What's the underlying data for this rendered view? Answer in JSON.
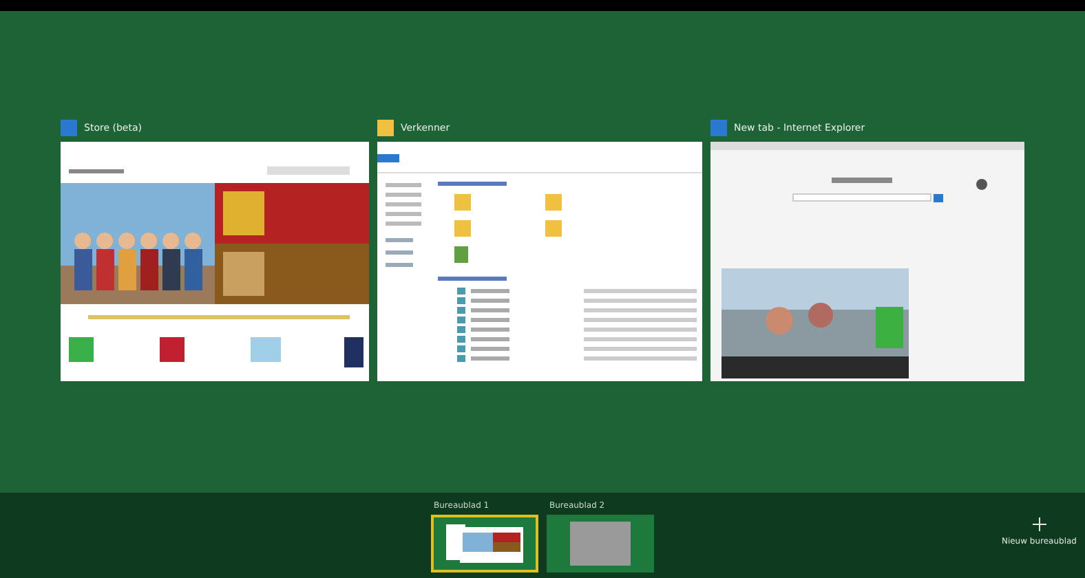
{
  "windows": [
    {
      "kind": "store",
      "title": "Store (beta)"
    },
    {
      "kind": "explorer",
      "title": "Verkenner"
    },
    {
      "kind": "browser",
      "title": "New tab - Internet Explorer"
    }
  ],
  "desktops": [
    {
      "label": "Bureaublad 1",
      "selected": true
    },
    {
      "label": "Bureaublad 2",
      "selected": false
    }
  ],
  "new_desktop": {
    "label": "Nieuw bureaublad"
  }
}
